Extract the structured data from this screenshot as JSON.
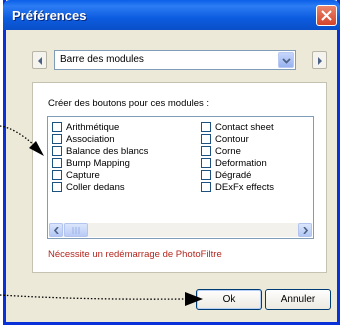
{
  "window": {
    "title": "Préférences"
  },
  "module_select": {
    "selected": "Barre des modules"
  },
  "panel": {
    "label": "Créer des boutons pour ces modules :",
    "column1": [
      "Arithmétique",
      "Association",
      "Balance des blancs",
      "Bump Mapping",
      "Capture",
      "Coller dedans"
    ],
    "column2": [
      "Contact sheet",
      "Contour",
      "Corne",
      "Deformation",
      "Dégradé",
      "DExFx effects"
    ],
    "note": "Nécessite un redémarrage de PhotoFiltre"
  },
  "buttons": {
    "ok": "Ok",
    "cancel": "Annuler"
  },
  "icons": {
    "close": "close-icon",
    "prev": "chevron-left-icon",
    "next": "chevron-right-icon",
    "dropdown": "chevron-down-icon"
  }
}
